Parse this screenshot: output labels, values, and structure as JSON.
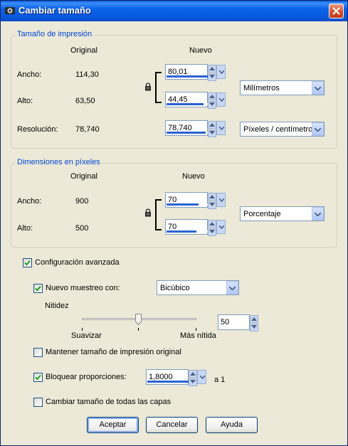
{
  "window": {
    "title": "Cambiar tamaño"
  },
  "print_size": {
    "group_title": "Tamaño de impresión",
    "col_original": "Original",
    "col_new": "Nuevo",
    "width_label": "Ancho:",
    "height_label": "Alto:",
    "resolution_label": "Resolución:",
    "width_original": "114,30",
    "height_original": "63,50",
    "resolution_original": "78,740",
    "width_new": "80,01",
    "height_new": "44,45",
    "resolution_new": "78,740",
    "unit_select": "Milímetros",
    "resolution_unit_select": "Píxeles / centímetro"
  },
  "pixel_dims": {
    "group_title": "Dimensiones en píxeles",
    "col_original": "Original",
    "col_new": "Nuevo",
    "width_label": "Ancho:",
    "height_label": "Alto:",
    "width_original": "900",
    "height_original": "500",
    "width_new": "70",
    "height_new": "70",
    "unit_select": "Porcentaje"
  },
  "advanced": {
    "advanced_label": "Configuración avanzada",
    "advanced_checked": true,
    "resample_label": "Nuevo muestreo con:",
    "resample_checked": true,
    "resample_method": "Bicúbico",
    "sharpness_label": "Nitidez",
    "sharpness_value": "50",
    "sharpness_level": 0.5,
    "slider_min_label": "Suavizar",
    "slider_max_label": "Más nítida",
    "keep_print_size_label": "Mantener tamaño de impresión original",
    "keep_print_size_checked": false,
    "lock_ratio_label": "Bloquear proporciones:",
    "lock_ratio_checked": true,
    "ratio_value": "1,8000",
    "ratio_suffix": "a 1",
    "resize_all_layers_label": "Cambiar tamaño de todas las capas",
    "resize_all_layers_checked": false
  },
  "buttons": {
    "ok": "Aceptar",
    "cancel": "Cancelar",
    "help": "Ayuda"
  },
  "colors": {
    "title_bar": "#0a5ce0",
    "group_title": "#0046d5",
    "close_button": "#d6552f"
  }
}
